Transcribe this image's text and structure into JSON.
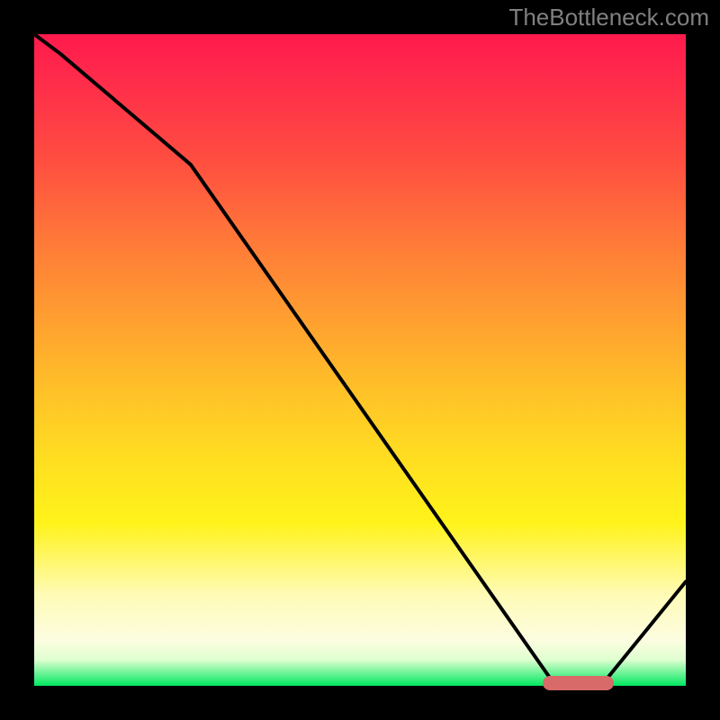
{
  "watermark": "TheBottleneck.com",
  "colors": {
    "page_bg": "#000000",
    "watermark": "#808080",
    "curve": "#000000",
    "marker": "#d96a6a",
    "gradient_top": "#ff1a4d",
    "gradient_bottom": "#00e860"
  },
  "chart_data": {
    "type": "line",
    "title": "",
    "xlabel": "",
    "ylabel": "",
    "xlim": [
      0,
      100
    ],
    "ylim": [
      0,
      100
    ],
    "x": [
      0,
      4,
      24,
      80,
      87,
      100
    ],
    "y": [
      100,
      97,
      80,
      0,
      0,
      16
    ],
    "series": [
      {
        "name": "bottleneck_curve",
        "x": [
          0,
          4,
          24,
          80,
          87,
          100
        ],
        "y": [
          100,
          97,
          80,
          0,
          0,
          16
        ]
      }
    ],
    "marker": {
      "x_start": 78,
      "x_end": 89,
      "y": 0
    },
    "annotations": []
  }
}
